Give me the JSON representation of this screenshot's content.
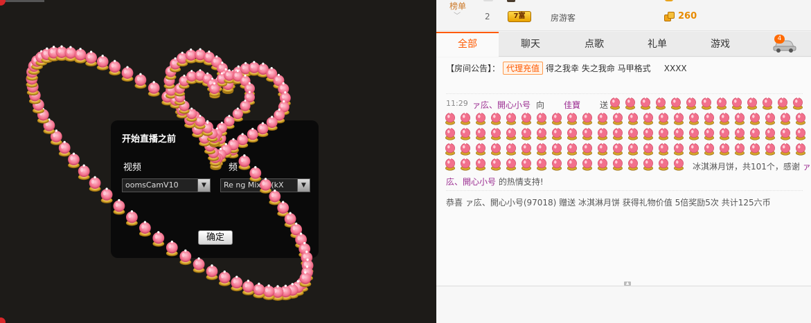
{
  "stage": {
    "dialog": {
      "title": "开始直播之前",
      "video_label": "视频",
      "audio_label": "频",
      "video_select": "oomsCamV10",
      "audio_select": "Re    ng Mixer (kX",
      "confirm": "确定"
    },
    "gift_name": "冰淇淋月饼"
  },
  "panel": {
    "rank": {
      "label": "榜单",
      "row2": {
        "rank": "2",
        "level": "7富",
        "name": "房游客",
        "coins": "260"
      }
    },
    "tabs": [
      {
        "label": "全部",
        "active": true
      },
      {
        "label": "聊天",
        "active": false
      },
      {
        "label": "点歌",
        "active": false
      },
      {
        "label": "礼单",
        "active": false
      },
      {
        "label": "游戏",
        "active": false
      }
    ],
    "car_badge": "4",
    "notice": {
      "prefix": "【房间公告】：",
      "badge": "代理充值",
      "text": "得之我幸 失之我命 马甲格式",
      "extra": "XXXX"
    },
    "message": {
      "time": "11:29",
      "user": "ァ庅、開心小号",
      "to": "向",
      "target": "佳寶",
      "give": "送",
      "tail1_gift": "冰淇淋月饼，共101个，感谢",
      "tail1_user": "ァ",
      "tail2_user": "庅、開心小号",
      "tail2_text": "的热情支持!"
    },
    "congrats": "恭喜 ァ庅、開心小号(97018) 赠送 冰淇淋月饼 获得礼物价值 5倍奖励5次 共计125六币"
  }
}
